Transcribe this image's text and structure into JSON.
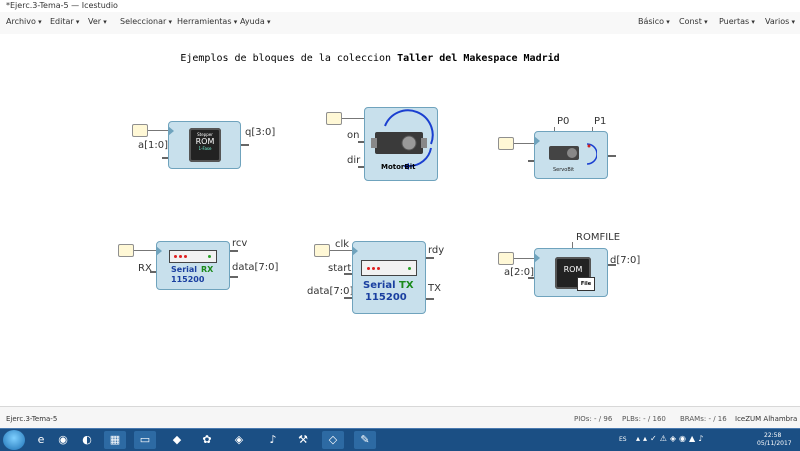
{
  "window": {
    "title": "*Ejerc.3-Tema-5 — Icestudio",
    "ghost_title": "ghost_title"
  },
  "menubar": {
    "left": [
      "Archivo",
      "Editar",
      "Ver",
      "Seleccionar",
      "Herramientas",
      "Ayuda"
    ],
    "right": [
      "Básico",
      "Const",
      "Puertas",
      "Varios"
    ]
  },
  "canvas": {
    "heading_plain": "Ejemplos de bloques de la coleccion ",
    "heading_bold": "Taller del Makespace Madrid",
    "blocks": {
      "stepper": {
        "input": "a[1:0]",
        "output": "q[3:0]",
        "chip_small": "Stepper",
        "chip_big": "ROM",
        "chip_tag": "1-Fase"
      },
      "motorbit": {
        "inputs": [
          "on",
          "dir"
        ],
        "label": "MotorBit"
      },
      "servobit": {
        "params": [
          "P0",
          "P1"
        ],
        "label": "ServoBit"
      },
      "serial_rx": {
        "input": "RX",
        "outputs": [
          "rcv",
          "data[7:0]"
        ],
        "serial": "Serial",
        "dir": "RX",
        "baud": "115200"
      },
      "serial_tx": {
        "inputs": [
          "clk",
          "start",
          "data[7:0]"
        ],
        "outputs": [
          "rdy",
          "TX"
        ],
        "serial": "Serial",
        "dir": "TX",
        "baud": "115200"
      },
      "rom_file": {
        "param": "ROMFILE",
        "input": "a[2:0]",
        "output": "d[7:0]",
        "chip": "ROM",
        "file": "File"
      }
    }
  },
  "statusbar": {
    "file": "Ejerc.3-Tema-5",
    "pios": "PIOs: - / 96",
    "plbs": "PLBs: - / 160",
    "brams": "BRAMs: - / 16",
    "board": "IceZUM Alhambra"
  },
  "taskbar": {
    "lang": "ES",
    "time": "22:58",
    "date": "05/11/2017",
    "apps": [
      "ie-icon",
      "chrome-icon",
      "firefox-icon",
      "control-panel-icon",
      "folder-icon",
      "inkscape-icon",
      "settings-app-icon",
      "geany-icon",
      "usb-icon",
      "tools-icon",
      "icestudio-icon",
      "paint-icon"
    ]
  },
  "colors": {
    "block_fill": "#c8e0ec",
    "block_border": "#6fa3bd",
    "input_fill": "#fff8d6",
    "taskbar": "#1b4f84"
  }
}
